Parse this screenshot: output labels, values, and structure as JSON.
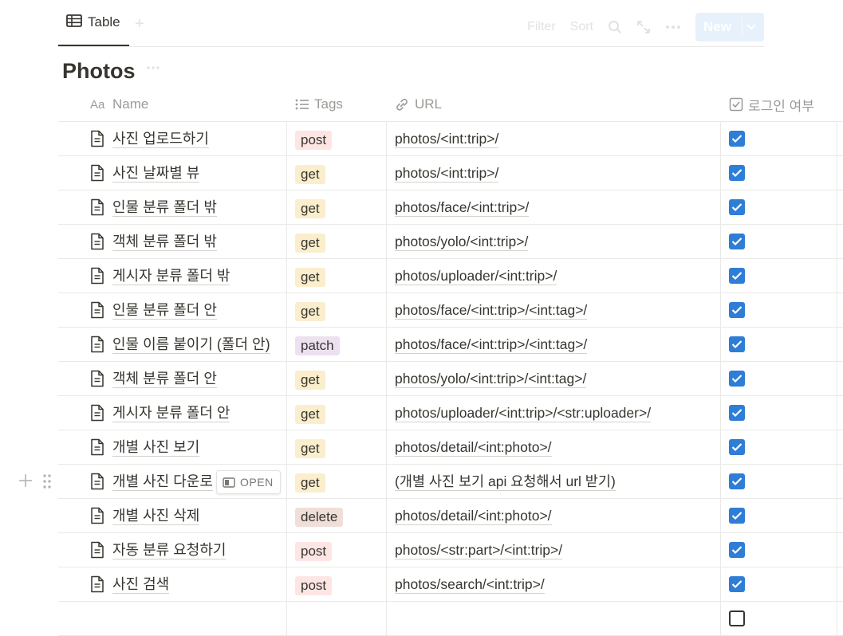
{
  "view": {
    "tab_label": "Table",
    "add_glyph": "+"
  },
  "toolbar": {
    "filter": "Filter",
    "sort": "Sort",
    "new_label": "New"
  },
  "page": {
    "title": "Photos"
  },
  "columns": {
    "name": {
      "label": "Name",
      "icon": "aa-icon"
    },
    "tags": {
      "label": "Tags",
      "icon": "list-icon"
    },
    "url": {
      "label": "URL",
      "icon": "link-icon"
    },
    "login": {
      "label": "로그인 여부",
      "icon": "checkbox-icon"
    }
  },
  "tag_colors": {
    "post": "#fde5e3",
    "get": "#fbeecd",
    "patch": "#ece0f1",
    "delete": "#f0dfd8"
  },
  "check_color": "#2e7dd6",
  "rows": [
    {
      "name": "사진 업로드하기",
      "tag": "post",
      "url": "photos/<int:trip>/",
      "login": true
    },
    {
      "name": "사진 날짜별 뷰",
      "tag": "get",
      "url": "photos/<int:trip>/",
      "login": true
    },
    {
      "name": "인물 분류 폴더 밖",
      "tag": "get",
      "url": "photos/face/<int:trip>/",
      "login": true
    },
    {
      "name": "객체 분류 폴더 밖",
      "tag": "get",
      "url": "photos/yolo/<int:trip>/",
      "login": true
    },
    {
      "name": "게시자 분류 폴더 밖",
      "tag": "get",
      "url": "photos/uploader/<int:trip>/",
      "login": true
    },
    {
      "name": "인물 분류 폴더 안",
      "tag": "get",
      "url": "photos/face/<int:trip>/<int:tag>/",
      "login": true
    },
    {
      "name": "인물 이름 붙이기 (폴더 안)",
      "tag": "patch",
      "url": "photos/face/<int:trip>/<int:tag>/",
      "login": true
    },
    {
      "name": "객체 분류 폴더 안",
      "tag": "get",
      "url": "photos/yolo/<int:trip>/<int:tag>/",
      "login": true
    },
    {
      "name": "게시자 분류 폴더 안",
      "tag": "get",
      "url": "photos/uploader/<int:trip>/<str:uploader>/",
      "login": true
    },
    {
      "name": "개별 사진 보기",
      "tag": "get",
      "url": "photos/detail/<int:photo>/",
      "login": true
    },
    {
      "name": "개별 사진 다운로",
      "tag": "get",
      "url": "(개별 사진 보기 api 요청해서 url 받기)",
      "login": true,
      "hover": true,
      "open_label": "OPEN"
    },
    {
      "name": "개별 사진 삭제",
      "tag": "delete",
      "url": "photos/detail/<int:photo>/",
      "login": true
    },
    {
      "name": "자동 분류 요청하기",
      "tag": "post",
      "url": "photos/<str:part>/<int:trip>/",
      "login": true
    },
    {
      "name": "사진 검색",
      "tag": "post",
      "url": "photos/search/<int:trip>/",
      "login": true
    },
    {
      "name": "",
      "tag": "",
      "url": "",
      "login": false
    }
  ]
}
